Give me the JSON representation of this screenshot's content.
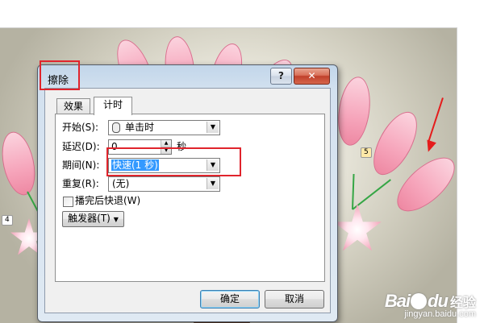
{
  "slide": {
    "animation_order_left": "4",
    "animation_order_right": "5"
  },
  "dialog": {
    "title": "擦除",
    "help_button": "?",
    "close_button": "✕",
    "tabs": [
      {
        "label": "效果",
        "selected": false
      },
      {
        "label": "计时",
        "selected": true
      }
    ],
    "fields": {
      "start": {
        "label": "开始(S):",
        "value": "单击时",
        "icon": "mouse-icon"
      },
      "delay": {
        "label": "延迟(D):",
        "value": "0",
        "unit": "秒"
      },
      "duration": {
        "label": "期间(N):",
        "value": "快速(1 秒)"
      },
      "repeat": {
        "label": "重复(R):",
        "value": "(无)"
      },
      "rewind": {
        "label": "播完后快退(W)",
        "checked": false
      },
      "triggers": {
        "label": "触发器(T)"
      }
    },
    "ok_button": "确定",
    "cancel_button": "取消"
  },
  "watermark": {
    "brand": "Bai",
    "brand_suffix": "du",
    "name": "经验",
    "url": "jingyan.baidu.com"
  },
  "colors": {
    "annotation_red": "#e0242c",
    "petal_pink": "#f6a5bb",
    "stem_green": "#35a645"
  }
}
